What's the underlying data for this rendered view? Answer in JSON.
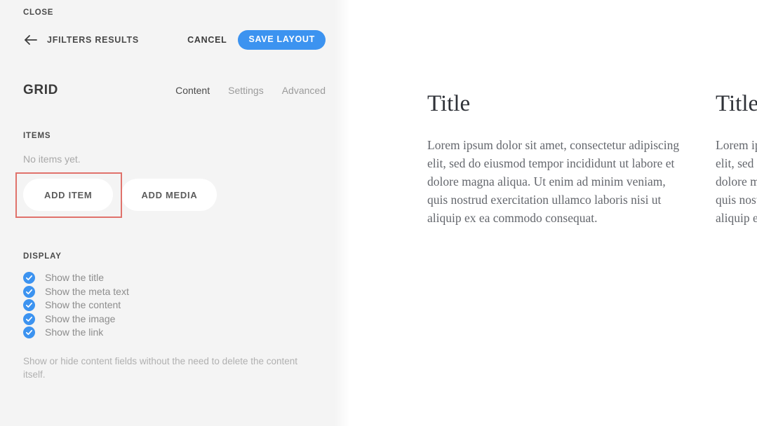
{
  "theme": {
    "accent_blue": "#3c93f0",
    "sidebar_bg": "#f4f4f4",
    "highlight_red": "#e0726b",
    "panel_bg": "#ffffff"
  },
  "sidebar": {
    "close_label": "CLOSE",
    "back_icon": "arrow-left-icon",
    "nav_title": "JFILTERS RESULTS",
    "cancel_label": "CANCEL",
    "save_label": "SAVE LAYOUT",
    "module_title": "GRID",
    "tabs": [
      {
        "label": "Content",
        "active": true
      },
      {
        "label": "Settings",
        "active": false
      },
      {
        "label": "Advanced",
        "active": false
      }
    ],
    "items_section": {
      "heading": "ITEMS",
      "empty_text": "No items yet.",
      "add_item_label": "ADD ITEM",
      "add_media_label": "ADD MEDIA"
    },
    "display_section": {
      "heading": "DISPLAY",
      "options": [
        {
          "label": "Show the title",
          "checked": true
        },
        {
          "label": "Show the meta text",
          "checked": true
        },
        {
          "label": "Show the content",
          "checked": true
        },
        {
          "label": "Show the image",
          "checked": true
        },
        {
          "label": "Show the link",
          "checked": true
        }
      ],
      "help_text": "Show or hide content fields without the need to delete the content itself."
    }
  },
  "preview": {
    "cards": [
      {
        "title": "Title",
        "body": "Lorem ipsum dolor sit amet, consectetur adipiscing elit, sed do eiusmod tempor incididunt ut labore et dolore magna aliqua. Ut enim ad minim veniam, quis nostrud exercitation ullamco laboris nisi ut aliquip ex ea commodo consequat."
      },
      {
        "title": "Title",
        "body": "Lorem ipsum dolor sit amet, consectetur adipiscing elit, sed do eiusmod tempor incididunt ut labore et dolore magna aliqua. Ut enim ad minim veniam, quis nostrud exercitation ullamco laboris nisi ut aliquip ex ea commodo consequat."
      }
    ]
  }
}
